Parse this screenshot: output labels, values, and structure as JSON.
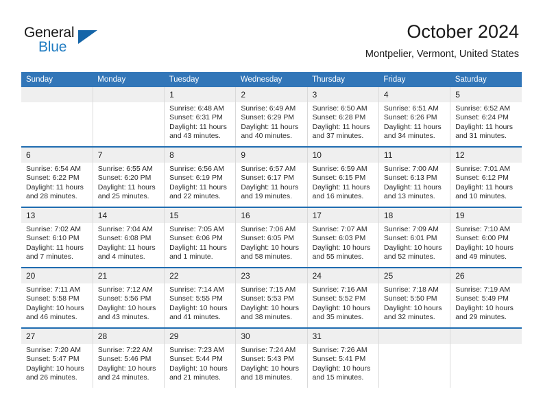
{
  "brand": {
    "word_one": "General",
    "word_two": "Blue",
    "logo_icon": "triangle-logo-icon",
    "colors": {
      "blue": "#1f7bc1",
      "dark_blue": "#1565a8",
      "header_blue": "#3276b8"
    }
  },
  "header": {
    "title": "October 2024",
    "location": "Montpelier, Vermont, United States"
  },
  "weekdays": [
    "Sunday",
    "Monday",
    "Tuesday",
    "Wednesday",
    "Thursday",
    "Friday",
    "Saturday"
  ],
  "weeks": [
    [
      {
        "day": "",
        "lines": []
      },
      {
        "day": "",
        "lines": []
      },
      {
        "day": "1",
        "lines": [
          "Sunrise: 6:48 AM",
          "Sunset: 6:31 PM",
          "Daylight: 11 hours",
          "and 43 minutes."
        ]
      },
      {
        "day": "2",
        "lines": [
          "Sunrise: 6:49 AM",
          "Sunset: 6:29 PM",
          "Daylight: 11 hours",
          "and 40 minutes."
        ]
      },
      {
        "day": "3",
        "lines": [
          "Sunrise: 6:50 AM",
          "Sunset: 6:28 PM",
          "Daylight: 11 hours",
          "and 37 minutes."
        ]
      },
      {
        "day": "4",
        "lines": [
          "Sunrise: 6:51 AM",
          "Sunset: 6:26 PM",
          "Daylight: 11 hours",
          "and 34 minutes."
        ]
      },
      {
        "day": "5",
        "lines": [
          "Sunrise: 6:52 AM",
          "Sunset: 6:24 PM",
          "Daylight: 11 hours",
          "and 31 minutes."
        ]
      }
    ],
    [
      {
        "day": "6",
        "lines": [
          "Sunrise: 6:54 AM",
          "Sunset: 6:22 PM",
          "Daylight: 11 hours",
          "and 28 minutes."
        ]
      },
      {
        "day": "7",
        "lines": [
          "Sunrise: 6:55 AM",
          "Sunset: 6:20 PM",
          "Daylight: 11 hours",
          "and 25 minutes."
        ]
      },
      {
        "day": "8",
        "lines": [
          "Sunrise: 6:56 AM",
          "Sunset: 6:19 PM",
          "Daylight: 11 hours",
          "and 22 minutes."
        ]
      },
      {
        "day": "9",
        "lines": [
          "Sunrise: 6:57 AM",
          "Sunset: 6:17 PM",
          "Daylight: 11 hours",
          "and 19 minutes."
        ]
      },
      {
        "day": "10",
        "lines": [
          "Sunrise: 6:59 AM",
          "Sunset: 6:15 PM",
          "Daylight: 11 hours",
          "and 16 minutes."
        ]
      },
      {
        "day": "11",
        "lines": [
          "Sunrise: 7:00 AM",
          "Sunset: 6:13 PM",
          "Daylight: 11 hours",
          "and 13 minutes."
        ]
      },
      {
        "day": "12",
        "lines": [
          "Sunrise: 7:01 AM",
          "Sunset: 6:12 PM",
          "Daylight: 11 hours",
          "and 10 minutes."
        ]
      }
    ],
    [
      {
        "day": "13",
        "lines": [
          "Sunrise: 7:02 AM",
          "Sunset: 6:10 PM",
          "Daylight: 11 hours",
          "and 7 minutes."
        ]
      },
      {
        "day": "14",
        "lines": [
          "Sunrise: 7:04 AM",
          "Sunset: 6:08 PM",
          "Daylight: 11 hours",
          "and 4 minutes."
        ]
      },
      {
        "day": "15",
        "lines": [
          "Sunrise: 7:05 AM",
          "Sunset: 6:06 PM",
          "Daylight: 11 hours",
          "and 1 minute."
        ]
      },
      {
        "day": "16",
        "lines": [
          "Sunrise: 7:06 AM",
          "Sunset: 6:05 PM",
          "Daylight: 10 hours",
          "and 58 minutes."
        ]
      },
      {
        "day": "17",
        "lines": [
          "Sunrise: 7:07 AM",
          "Sunset: 6:03 PM",
          "Daylight: 10 hours",
          "and 55 minutes."
        ]
      },
      {
        "day": "18",
        "lines": [
          "Sunrise: 7:09 AM",
          "Sunset: 6:01 PM",
          "Daylight: 10 hours",
          "and 52 minutes."
        ]
      },
      {
        "day": "19",
        "lines": [
          "Sunrise: 7:10 AM",
          "Sunset: 6:00 PM",
          "Daylight: 10 hours",
          "and 49 minutes."
        ]
      }
    ],
    [
      {
        "day": "20",
        "lines": [
          "Sunrise: 7:11 AM",
          "Sunset: 5:58 PM",
          "Daylight: 10 hours",
          "and 46 minutes."
        ]
      },
      {
        "day": "21",
        "lines": [
          "Sunrise: 7:12 AM",
          "Sunset: 5:56 PM",
          "Daylight: 10 hours",
          "and 43 minutes."
        ]
      },
      {
        "day": "22",
        "lines": [
          "Sunrise: 7:14 AM",
          "Sunset: 5:55 PM",
          "Daylight: 10 hours",
          "and 41 minutes."
        ]
      },
      {
        "day": "23",
        "lines": [
          "Sunrise: 7:15 AM",
          "Sunset: 5:53 PM",
          "Daylight: 10 hours",
          "and 38 minutes."
        ]
      },
      {
        "day": "24",
        "lines": [
          "Sunrise: 7:16 AM",
          "Sunset: 5:52 PM",
          "Daylight: 10 hours",
          "and 35 minutes."
        ]
      },
      {
        "day": "25",
        "lines": [
          "Sunrise: 7:18 AM",
          "Sunset: 5:50 PM",
          "Daylight: 10 hours",
          "and 32 minutes."
        ]
      },
      {
        "day": "26",
        "lines": [
          "Sunrise: 7:19 AM",
          "Sunset: 5:49 PM",
          "Daylight: 10 hours",
          "and 29 minutes."
        ]
      }
    ],
    [
      {
        "day": "27",
        "lines": [
          "Sunrise: 7:20 AM",
          "Sunset: 5:47 PM",
          "Daylight: 10 hours",
          "and 26 minutes."
        ]
      },
      {
        "day": "28",
        "lines": [
          "Sunrise: 7:22 AM",
          "Sunset: 5:46 PM",
          "Daylight: 10 hours",
          "and 24 minutes."
        ]
      },
      {
        "day": "29",
        "lines": [
          "Sunrise: 7:23 AM",
          "Sunset: 5:44 PM",
          "Daylight: 10 hours",
          "and 21 minutes."
        ]
      },
      {
        "day": "30",
        "lines": [
          "Sunrise: 7:24 AM",
          "Sunset: 5:43 PM",
          "Daylight: 10 hours",
          "and 18 minutes."
        ]
      },
      {
        "day": "31",
        "lines": [
          "Sunrise: 7:26 AM",
          "Sunset: 5:41 PM",
          "Daylight: 10 hours",
          "and 15 minutes."
        ]
      },
      {
        "day": "",
        "lines": []
      },
      {
        "day": "",
        "lines": []
      }
    ]
  ]
}
